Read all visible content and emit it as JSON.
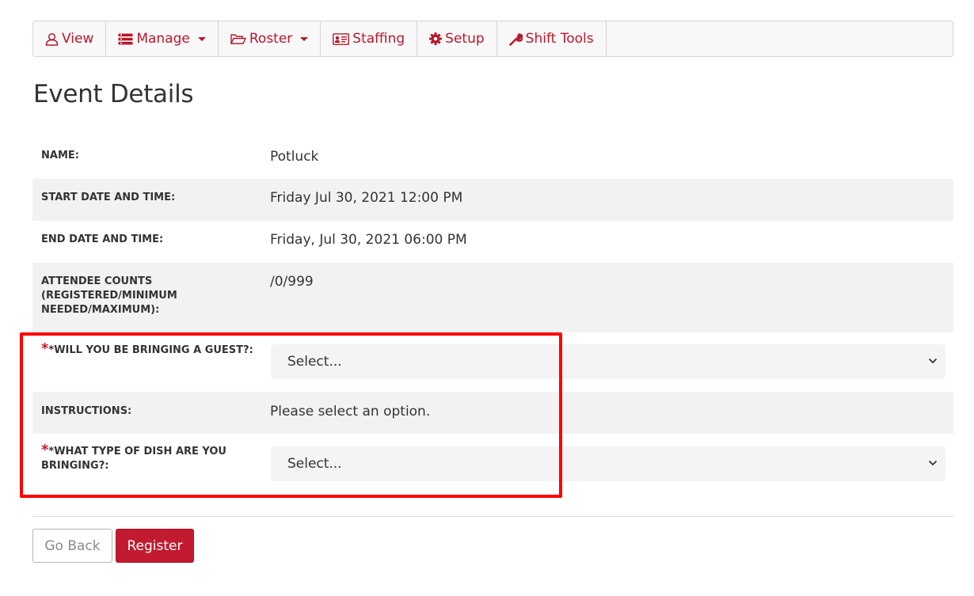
{
  "toolbar": {
    "items": [
      {
        "label": "View",
        "icon": "user-icon",
        "has_dropdown": false
      },
      {
        "label": "Manage",
        "icon": "list-icon",
        "has_dropdown": true
      },
      {
        "label": "Roster",
        "icon": "folder-open-icon",
        "has_dropdown": true
      },
      {
        "label": "Staffing",
        "icon": "id-card-icon",
        "has_dropdown": false
      },
      {
        "label": "Setup",
        "icon": "gear-icon",
        "has_dropdown": false
      },
      {
        "label": "Shift Tools",
        "icon": "wrench-icon",
        "has_dropdown": false
      }
    ]
  },
  "page": {
    "title": "Event Details"
  },
  "details": {
    "name_label": "NAME:",
    "name_value": "Potluck",
    "start_label": "START DATE AND TIME:",
    "start_value": "Friday Jul 30, 2021 12:00 PM",
    "end_label": "END DATE AND TIME:",
    "end_value": "Friday, Jul 30, 2021 06:00 PM",
    "attendee_label_1": "ATTENDEE COUNTS",
    "attendee_label_2": "(REGISTERED/MINIMUM",
    "attendee_label_3": "NEEDED/MAXIMUM):",
    "attendee_value": "/0/999",
    "guest_required_mark": "*",
    "guest_label": "*WILL YOU BE BRINGING A GUEST?:",
    "guest_select_value": "Select...",
    "instructions_label": "INSTRUCTIONS:",
    "instructions_value": "Please select an option.",
    "dish_required_mark": "*",
    "dish_label_1": "*WHAT TYPE OF DISH ARE YOU",
    "dish_label_2": "BRINGING?:",
    "dish_select_value": "Select..."
  },
  "actions": {
    "back_label": "Go Back",
    "register_label": "Register"
  },
  "colors": {
    "accent": "#b8182b",
    "highlight": "#ff0000",
    "shade": "#f2f2f2"
  }
}
